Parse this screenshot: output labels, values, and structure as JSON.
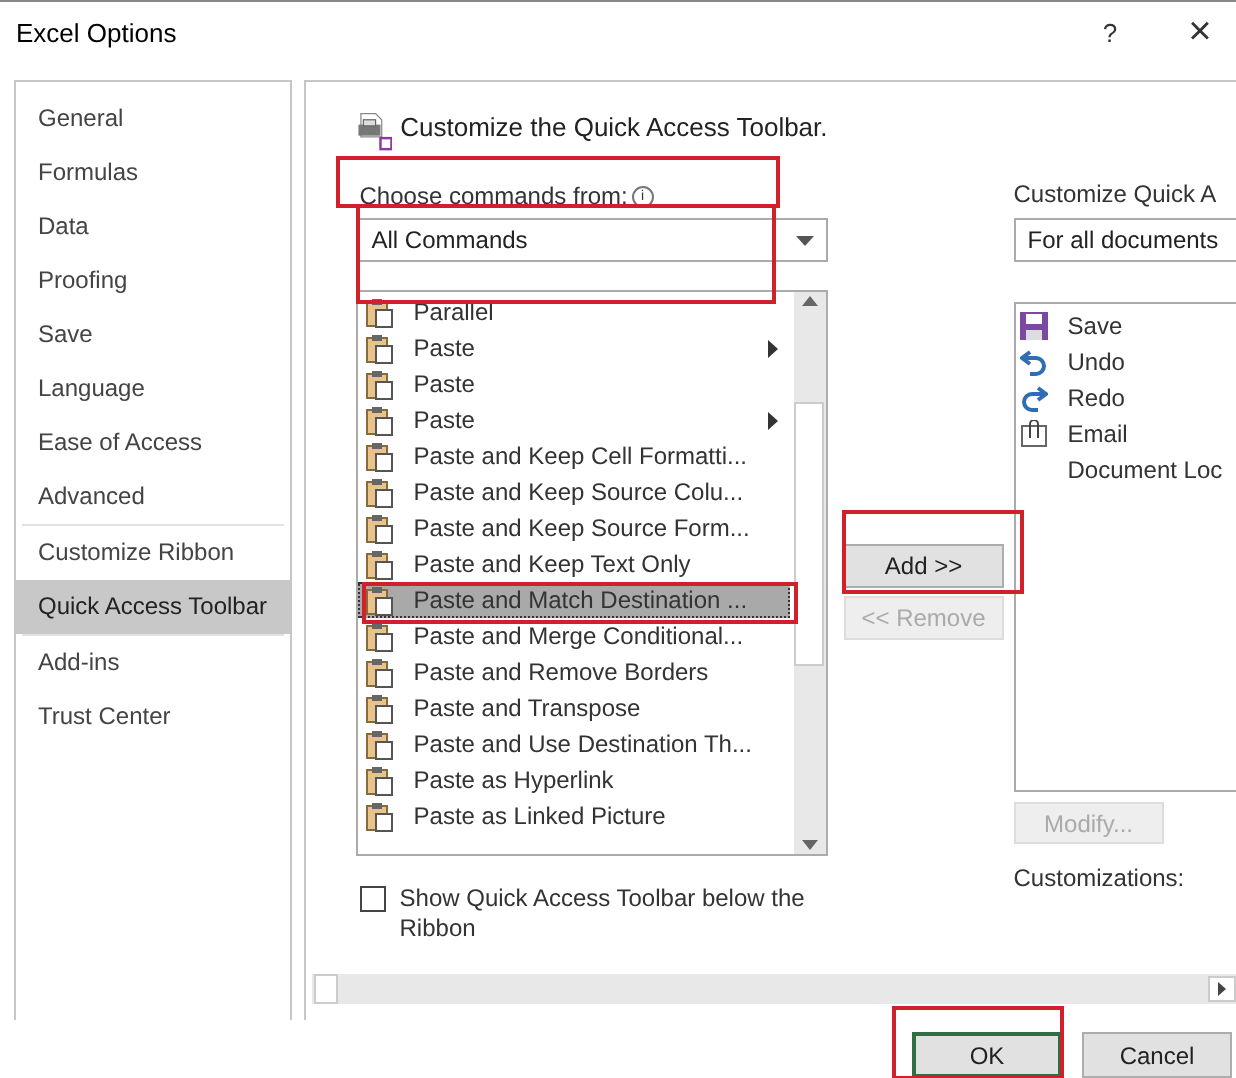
{
  "window": {
    "title": "Excel Options",
    "help": "?",
    "close": "×"
  },
  "sidebar": {
    "items": [
      {
        "label": "General",
        "selected": false,
        "divider_after": false
      },
      {
        "label": "Formulas",
        "selected": false,
        "divider_after": false
      },
      {
        "label": "Data",
        "selected": false,
        "divider_after": false
      },
      {
        "label": "Proofing",
        "selected": false,
        "divider_after": false
      },
      {
        "label": "Save",
        "selected": false,
        "divider_after": false
      },
      {
        "label": "Language",
        "selected": false,
        "divider_after": false
      },
      {
        "label": "Ease of Access",
        "selected": false,
        "divider_after": false
      },
      {
        "label": "Advanced",
        "selected": false,
        "divider_after": true
      },
      {
        "label": "Customize Ribbon",
        "selected": false,
        "divider_after": false
      },
      {
        "label": "Quick Access Toolbar",
        "selected": true,
        "divider_after": true
      },
      {
        "label": "Add-ins",
        "selected": false,
        "divider_after": false
      },
      {
        "label": "Trust Center",
        "selected": false,
        "divider_after": false
      }
    ]
  },
  "header": {
    "title": "Customize the Quick Access Toolbar."
  },
  "choose": {
    "label": "Choose commands from:",
    "info": "i",
    "value": "All Commands"
  },
  "commands": [
    {
      "label": "Parallel",
      "selected": false,
      "submenu": false
    },
    {
      "label": "Paste",
      "selected": false,
      "submenu": true
    },
    {
      "label": "Paste",
      "selected": false,
      "submenu": false
    },
    {
      "label": "Paste",
      "selected": false,
      "submenu": true
    },
    {
      "label": "Paste and Keep Cell Formatti...",
      "selected": false,
      "submenu": false
    },
    {
      "label": "Paste and Keep Source Colu...",
      "selected": false,
      "submenu": false
    },
    {
      "label": "Paste and Keep Source Form...",
      "selected": false,
      "submenu": false
    },
    {
      "label": "Paste and Keep Text Only",
      "selected": false,
      "submenu": false
    },
    {
      "label": "Paste and Match Destination ...",
      "selected": true,
      "submenu": false
    },
    {
      "label": "Paste and Merge Conditional...",
      "selected": false,
      "submenu": false
    },
    {
      "label": "Paste and Remove Borders",
      "selected": false,
      "submenu": false
    },
    {
      "label": "Paste and Transpose",
      "selected": false,
      "submenu": false
    },
    {
      "label": "Paste and Use Destination Th...",
      "selected": false,
      "submenu": false
    },
    {
      "label": "Paste as Hyperlink",
      "selected": false,
      "submenu": false
    },
    {
      "label": "Paste as Linked Picture",
      "selected": false,
      "submenu": false
    }
  ],
  "show_below": {
    "label": "Show Quick Access Toolbar below the Ribbon",
    "checked": false
  },
  "add_button": {
    "label": "Add >>",
    "disabled": false
  },
  "remove_button": {
    "label": "<< Remove",
    "disabled": true
  },
  "customize": {
    "label": "Customize Quick A",
    "value": "For all documents"
  },
  "toolbar_items": [
    {
      "label": "Save"
    },
    {
      "label": "Undo"
    },
    {
      "label": "Redo"
    },
    {
      "label": "Email"
    },
    {
      "label": "Document Loc"
    }
  ],
  "modify_button": {
    "label": "Modify...",
    "disabled": true
  },
  "customizations": {
    "label": "Customizations:"
  },
  "buttons": {
    "ok": "OK",
    "cancel": "Cancel"
  }
}
